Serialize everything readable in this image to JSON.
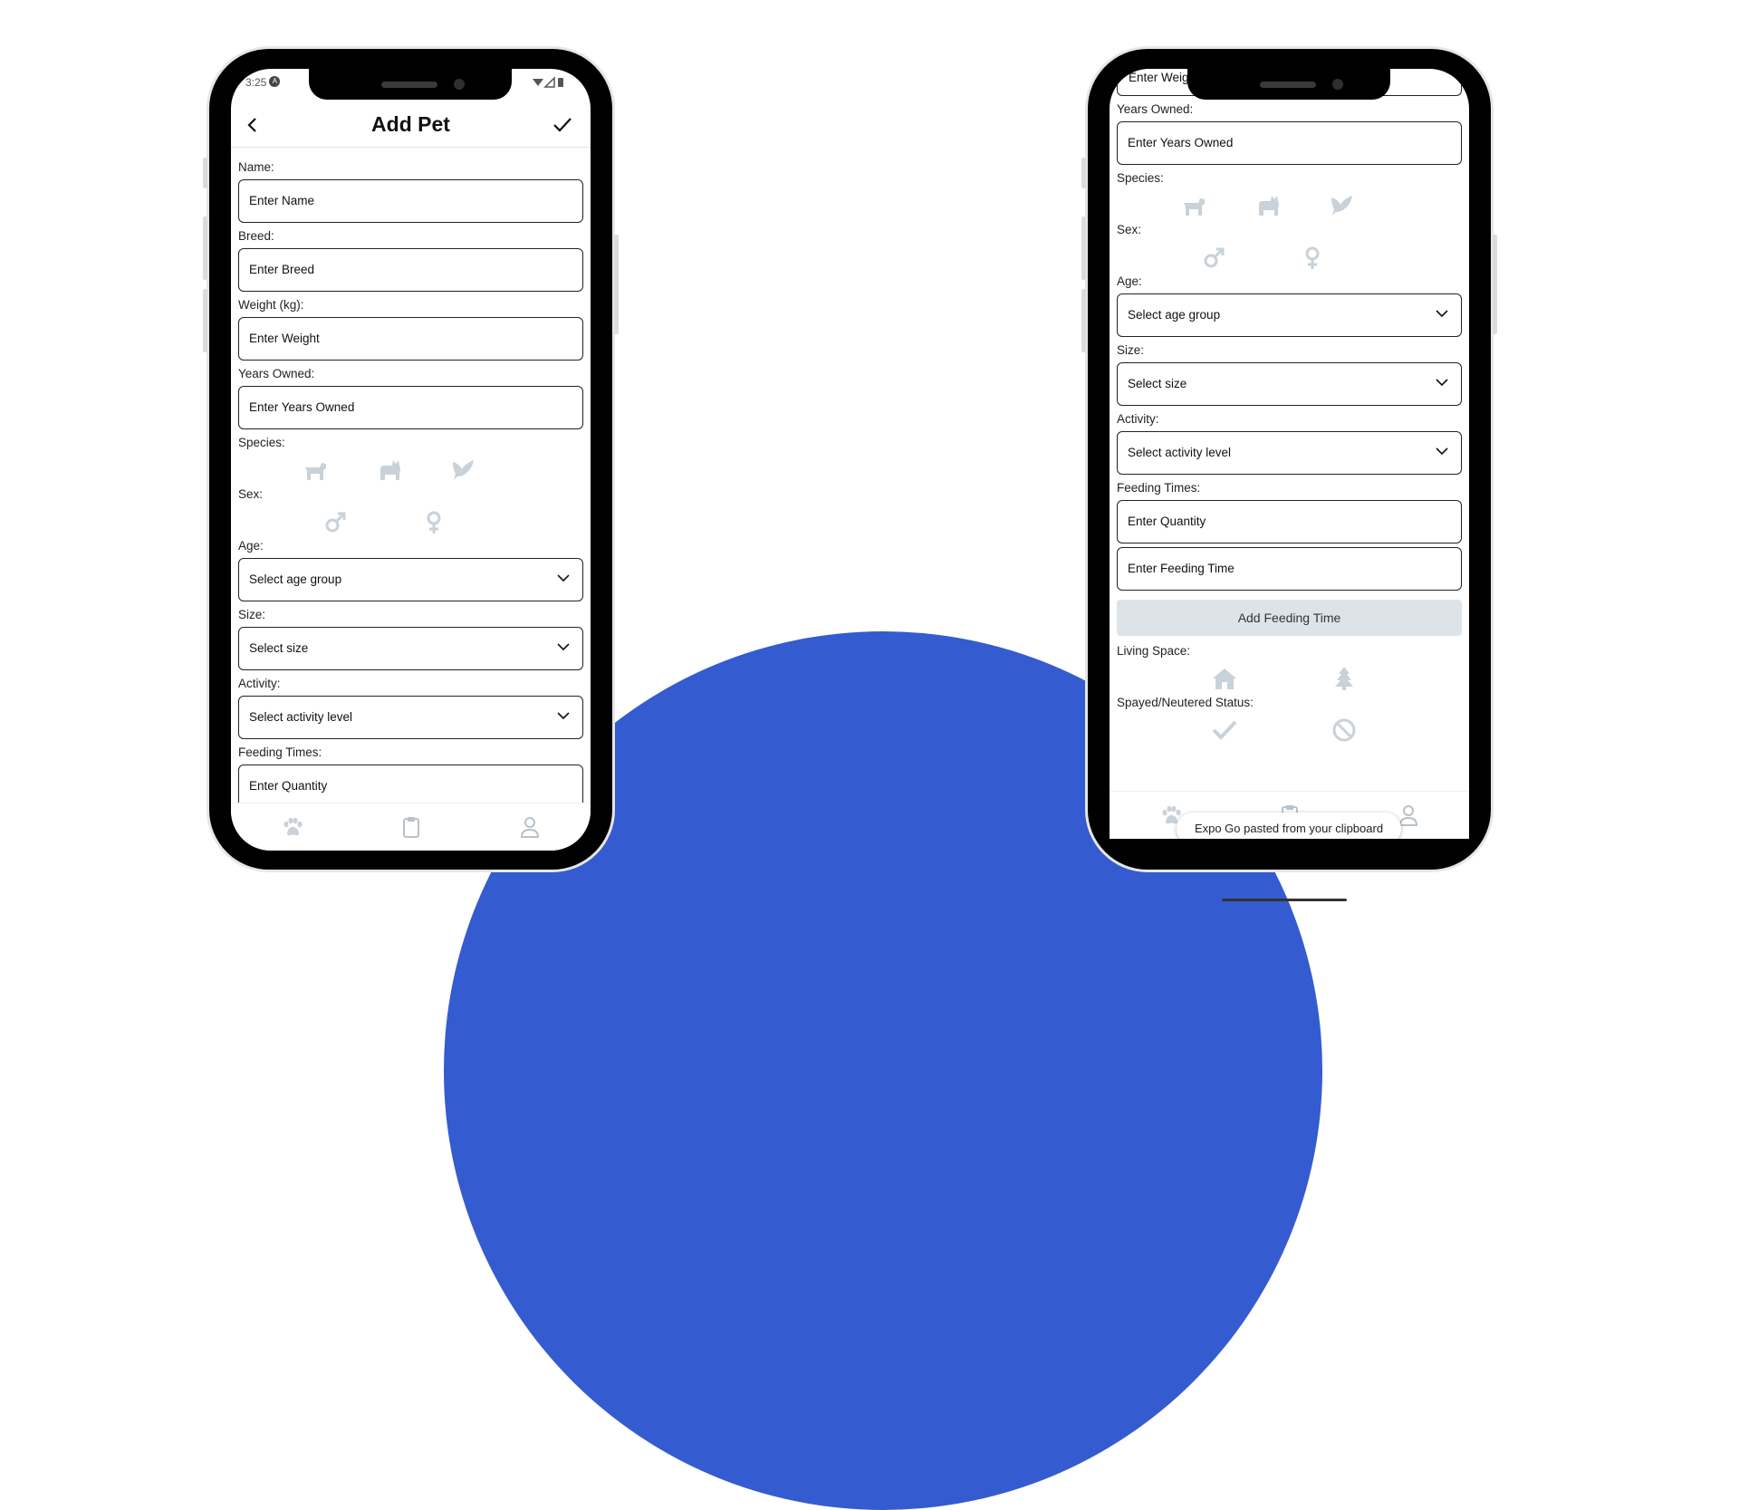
{
  "colors": {
    "accent": "#355bd0",
    "icon_muted": "#c8d2d8",
    "button_bg": "#dde4e9"
  },
  "phone1": {
    "status": {
      "time": "3:25",
      "badge": "A"
    },
    "header": {
      "title": "Add Pet"
    },
    "fields": [
      {
        "label": "Name:",
        "placeholder": "Enter Name"
      },
      {
        "label": "Breed:",
        "placeholder": "Enter Breed"
      },
      {
        "label": "Weight (kg):",
        "placeholder": "Enter Weight"
      },
      {
        "label": "Years Owned:",
        "placeholder": "Enter Years Owned"
      }
    ],
    "species_label": "Species:",
    "sex_label": "Sex:",
    "selects": [
      {
        "label": "Age:",
        "value": "Select age group"
      },
      {
        "label": "Size:",
        "value": "Select size"
      },
      {
        "label": "Activity:",
        "value": "Select activity level"
      }
    ],
    "feeding_label": "Feeding Times:",
    "quantity_placeholder": "Enter Quantity"
  },
  "phone2": {
    "partial_field": "Enter Weig",
    "years": {
      "label": "Years Owned:",
      "placeholder": "Enter Years Owned"
    },
    "species_label": "Species:",
    "sex_label": "Sex:",
    "selects": [
      {
        "label": "Age:",
        "value": "Select age group"
      },
      {
        "label": "Size:",
        "value": "Select size"
      },
      {
        "label": "Activity:",
        "value": "Select activity level"
      }
    ],
    "feeding_label": "Feeding Times:",
    "quantity_placeholder": "Enter Quantity",
    "feeding_time_placeholder": "Enter Feeding Time",
    "add_feeding_button": "Add Feeding Time",
    "living_label": "Living Space:",
    "spayed_label": "Spayed/Neutered Status:",
    "toast": "Expo Go pasted from your clipboard"
  },
  "icons": {
    "species": [
      "dog-icon",
      "cat-icon",
      "bird-icon"
    ],
    "sex": [
      "male-icon",
      "female-icon"
    ],
    "living": [
      "house-icon",
      "tree-icon"
    ],
    "spayed": [
      "checkmark-icon",
      "ban-icon"
    ],
    "tabs": [
      "paw-icon",
      "clipboard-icon",
      "user-icon"
    ]
  }
}
